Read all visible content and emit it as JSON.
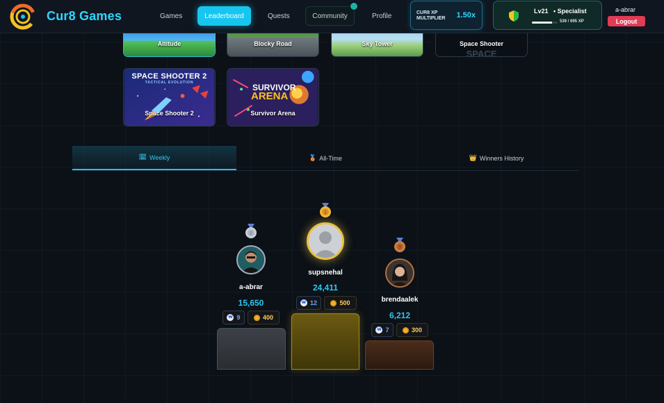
{
  "header": {
    "brand": "Cur8 Games",
    "nav": [
      {
        "label": "Games",
        "active": false
      },
      {
        "label": "Leaderboard",
        "active": true
      },
      {
        "label": "Quests",
        "active": false
      },
      {
        "label": "Community",
        "active": false,
        "notification": true
      },
      {
        "label": "Profile",
        "active": false
      }
    ],
    "multiplier": {
      "label_line1": "CUR8 XP",
      "label_line2": "MULTIPLIER",
      "value": "1.50x"
    },
    "level": {
      "level": "Lv21",
      "title": "• Specialist",
      "xp_text": "539 / 695 XP",
      "xp_fraction": 0.7755
    },
    "user": {
      "name": "a-abrar",
      "logout_label": "Logout"
    }
  },
  "games": [
    {
      "title": "Altitude"
    },
    {
      "title": "Blocky Road"
    },
    {
      "title": "Sky Tower"
    },
    {
      "title": "Space Shooter",
      "art_text": "SPACE"
    },
    {
      "title": "Space Shooter 2",
      "art_line1": "SPACE SHOOTER 2",
      "art_line2": "TACTICAL EVOLUTION"
    },
    {
      "title": "Survivor Arena",
      "art_line1": "SURVIVOR",
      "art_line2": "ARENA"
    }
  ],
  "tabs": [
    {
      "label": "Weekly",
      "icon": "calendar-icon",
      "active": true
    },
    {
      "label": "All-Time",
      "icon": "medal-icon",
      "active": false
    },
    {
      "label": "Winners History",
      "icon": "crown-icon",
      "active": false
    }
  ],
  "podium": [
    {
      "rank": "2",
      "name": "a-abrar",
      "score": "15,650",
      "badge_value": "9",
      "coins": "400",
      "medal_color": "#c9cfd8"
    },
    {
      "rank": "1",
      "name": "supsnehal",
      "score": "24,411",
      "badge_value": "12",
      "coins": "500",
      "medal_color": "#f2b63a"
    },
    {
      "rank": "3",
      "name": "brendaalek",
      "score": "6,212",
      "badge_value": "7",
      "coins": "300",
      "medal_color": "#cd7f45"
    }
  ],
  "colors": {
    "accent": "#17c6f0",
    "gold": "#f2b63a",
    "silver": "#c9cfd8",
    "bronze": "#cd7f45",
    "logout": "#e23b56"
  }
}
